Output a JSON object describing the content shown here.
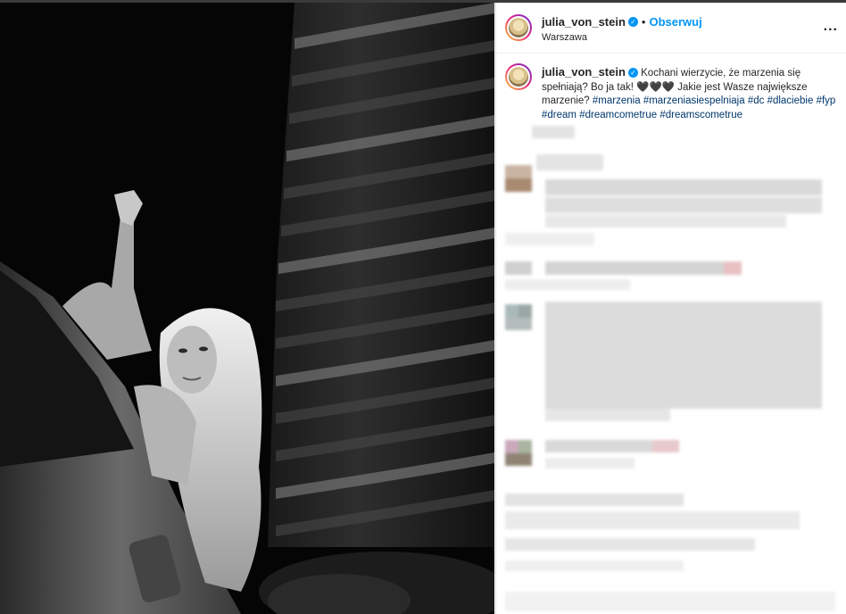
{
  "post": {
    "username": "julia_von_stein",
    "location": "Warszawa",
    "follow_label": "Obserwuj",
    "separator": "•",
    "more_label": "...",
    "verified_glyph": "✓",
    "caption_text": "Kochani wierzycie, że marzenia się spełniają? Bo ja tak! 🖤🖤🖤 Jakie jest Wasze największe marzenie?",
    "hashtags": [
      "#marzenia",
      "#marzeniasiespelniaja",
      "#dc",
      "#dlaciebie",
      "#fyp",
      "#dream",
      "#dreamcometrue",
      "#dreamscometrue"
    ]
  },
  "colors": {
    "accent": "#0095f6",
    "hashtag": "#00376b",
    "text": "#262626"
  },
  "icons": [
    "verified-badge-icon",
    "more-options-icon",
    "avatar"
  ]
}
